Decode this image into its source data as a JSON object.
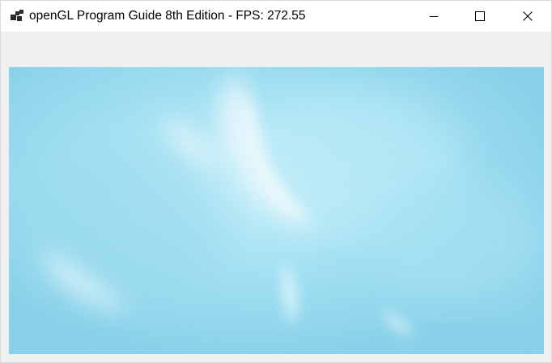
{
  "window": {
    "title": "openGL Program Guide 8th Edition - FPS: 272.55",
    "icon": "opengl-app-icon"
  },
  "titlebar_buttons": {
    "minimize_icon": "minimize-icon",
    "maximize_icon": "maximize-icon",
    "close_icon": "close-icon"
  },
  "viewport": {
    "content": "particle-noise-render",
    "colors": {
      "base": "#84d2ea",
      "light": "#b8ecf8",
      "highlight": "#ffffff",
      "background": "#f0f0f0"
    }
  }
}
